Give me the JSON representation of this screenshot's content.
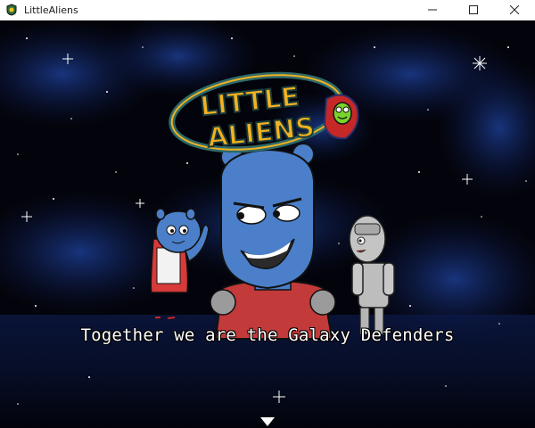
{
  "window": {
    "title": "LittleAliens",
    "controls": {
      "minimize": "minimize",
      "maximize": "maximize",
      "close": "close"
    }
  },
  "logo": {
    "line1": "LITTLE",
    "line2": "ALIENS",
    "colors": {
      "ring": "#2f6a6a",
      "text": "#f2b21f",
      "alien": "#c62828"
    }
  },
  "dialogue": {
    "text": "Together we are the Galaxy Defenders"
  },
  "colors": {
    "sky": "#03040b",
    "nebula": "#132a6b",
    "alien_blue": "#4b7fc9",
    "robot_grey": "#bdbdbd",
    "suit_red": "#c23a3a"
  }
}
